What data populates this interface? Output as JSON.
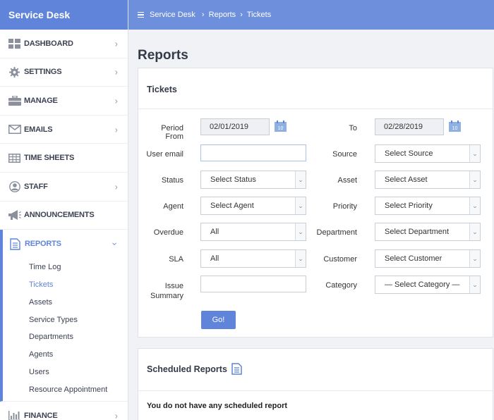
{
  "sidebar": {
    "brand": "Service Desk",
    "items": [
      {
        "label": "DASHBOARD",
        "icon": "dashboard-grid-icon",
        "has_chevron": true
      },
      {
        "label": "SETTINGS",
        "icon": "gear-icon",
        "has_chevron": true
      },
      {
        "label": "MANAGE",
        "icon": "briefcase-icon",
        "has_chevron": true
      },
      {
        "label": "EMAILS",
        "icon": "envelope-icon",
        "has_chevron": true
      },
      {
        "label": "TIME SHEETS",
        "icon": "table-icon",
        "has_chevron": false
      },
      {
        "label": "STAFF",
        "icon": "user-circle-icon",
        "has_chevron": true
      },
      {
        "label": "ANNOUNCEMENTS",
        "icon": "megaphone-icon",
        "has_chevron": false
      },
      {
        "label": "REPORTS",
        "icon": "document-icon",
        "has_chevron": true
      },
      {
        "label": "FINANCE",
        "icon": "bar-chart-icon",
        "has_chevron": true
      }
    ],
    "reports_sub": [
      "Time Log",
      "Tickets",
      "Assets",
      "Service Types",
      "Departments",
      "Agents",
      "Users",
      "Resource Appointment"
    ],
    "active_sub": "Tickets"
  },
  "topbar": {
    "crumbs": [
      "Service Desk",
      "Reports",
      "Tickets"
    ]
  },
  "page_title": "Reports",
  "tickets_form": {
    "title": "Tickets",
    "period_from_label": "Period From",
    "period_from_value": "02/01/2019",
    "to_label": "To",
    "to_value": "02/28/2019",
    "calendar_day": "10",
    "user_email_label": "User email",
    "user_email_value": "",
    "source_label": "Source",
    "source_value": "Select Source",
    "status_label": "Status",
    "status_value": "Select Status",
    "asset_label": "Asset",
    "asset_value": "Select Asset",
    "agent_label": "Agent",
    "agent_value": "Select Agent",
    "priority_label": "Priority",
    "priority_value": "Select Priority",
    "overdue_label": "Overdue",
    "overdue_value": "All",
    "department_label": "Department",
    "department_value": "Select Department",
    "sla_label": "SLA",
    "sla_value": "All",
    "customer_label": "Customer",
    "customer_value": "Select Customer",
    "issue_summary_label_1": "Issue",
    "issue_summary_label_2": "Summary",
    "issue_summary_value": "",
    "category_label": "Category",
    "category_value": "— Select Category —",
    "go_label": "Go!"
  },
  "scheduled": {
    "title": "Scheduled Reports",
    "empty_message": "You do not have any scheduled report"
  },
  "colors": {
    "accent": "#5f84d9",
    "topbar": "#6e8fdc"
  }
}
